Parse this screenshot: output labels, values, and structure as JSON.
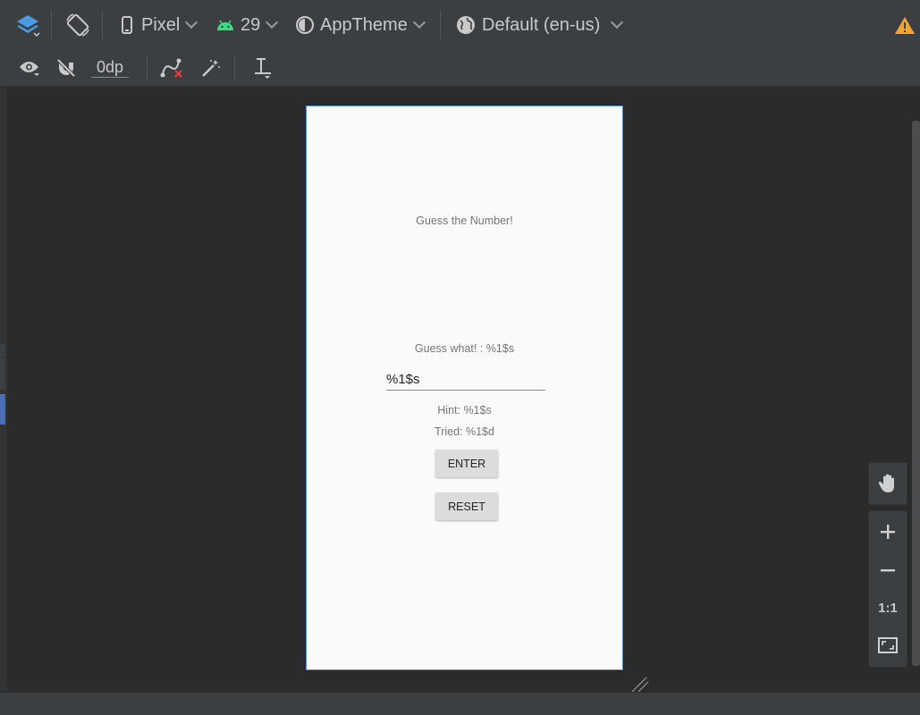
{
  "toolbar_top": {
    "device": "Pixel",
    "api_level": "29",
    "theme": "AppTheme",
    "locale": "Default (en-us)"
  },
  "toolbar_second": {
    "default_margin": "0dp"
  },
  "device_screen": {
    "title": "Guess the Number!",
    "guess_label": "Guess what! : %1$s",
    "input_value": "%1$s",
    "hint": "Hint: %1$s",
    "tried": "Tried: %1$d",
    "enter_button": "ENTER",
    "reset_button": "RESET"
  },
  "zoom_controls": {
    "actual_size": "1:1"
  },
  "icons": [
    "layers-icon",
    "orientation-icon",
    "phone-icon",
    "android-icon",
    "theme-icon",
    "globe-icon",
    "warning-icon",
    "eye-icon",
    "magnet-off-icon",
    "clear-constraints-icon",
    "infer-constraints-icon",
    "guidelines-icon",
    "pan-hand-icon",
    "zoom-in-icon",
    "zoom-out-icon",
    "zoom-fit-icon",
    "resize-handle-icon"
  ],
  "colors": {
    "accent_blue": "#4a88c7",
    "android_green": "#3ddc84",
    "warning": "#f0a732"
  }
}
